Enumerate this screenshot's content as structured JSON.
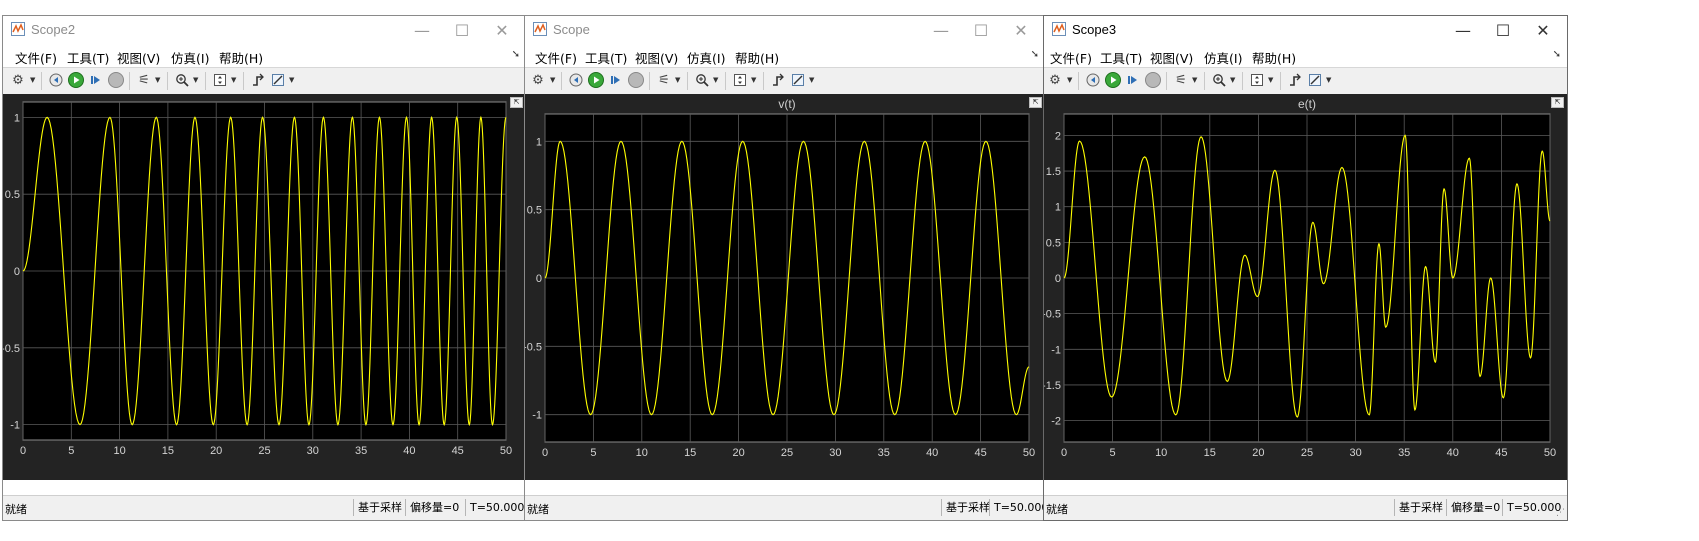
{
  "menu": [
    "文件(F)",
    "工具(T)",
    "视图(V)",
    "仿真(I)",
    "帮助(H)"
  ],
  "status": {
    "ready": "就绪",
    "sampling": "基于采样",
    "offset": "偏移量=0",
    "time": "T=50.000"
  },
  "window_controls": {
    "minimize": "—",
    "maximize": "☐",
    "close": "✕"
  },
  "colors": {
    "trace": "#ffff00",
    "plot_bg": "#000000",
    "frame_bg": "#232323",
    "grid": "#5a5a5a",
    "tick_label": "#d4d4d4"
  },
  "windows": [
    {
      "title": "Scope2",
      "active": false,
      "plot_title": ""
    },
    {
      "title": "Scope",
      "active": false,
      "plot_title": "v(t)"
    },
    {
      "title": "Scope3",
      "active": true,
      "plot_title": "e(t)"
    }
  ],
  "chart_data": [
    {
      "type": "line",
      "title": "",
      "xlabel": "",
      "ylabel": "",
      "xlim": [
        0,
        50
      ],
      "ylim": [
        -1.1,
        1.1
      ],
      "xticks": [
        0,
        5,
        10,
        15,
        20,
        25,
        30,
        35,
        40,
        45,
        50
      ],
      "yticks": [
        -1,
        -0.5,
        0,
        0.5,
        1
      ],
      "grid": true,
      "series": [
        {
          "x": [
            0,
            2.5,
            5.9,
            9,
            11.3,
            13.8,
            15.9,
            17.8,
            19.7,
            21.5,
            23.2,
            24.8,
            26.5,
            28.1,
            29.6,
            31.1,
            32.6,
            34.1,
            35.5,
            36.9,
            38.3,
            39.7,
            41.0,
            42.3,
            43.6,
            44.9,
            46.2,
            47.4,
            48.6,
            50
          ],
          "y": [
            0,
            1,
            -1,
            1,
            -1,
            1,
            -1,
            1,
            -1,
            1,
            -1,
            1,
            -1,
            1,
            -1,
            1,
            -1,
            1,
            -1,
            1,
            -1,
            1,
            -1,
            1,
            -1,
            1,
            -1,
            1,
            -1,
            1
          ]
        }
      ]
    },
    {
      "type": "line",
      "title": "v(t)",
      "xlabel": "",
      "ylabel": "",
      "xlim": [
        0,
        50
      ],
      "ylim": [
        -1.2,
        1.2
      ],
      "xticks": [
        0,
        5,
        10,
        15,
        20,
        25,
        30,
        35,
        40,
        45,
        50
      ],
      "yticks": [
        -1,
        -0.5,
        0,
        0.5,
        1
      ],
      "grid": true,
      "series": [
        {
          "x": [
            0,
            1.57,
            4.71,
            7.85,
            11.0,
            14.14,
            17.28,
            20.42,
            23.56,
            26.7,
            29.85,
            32.99,
            36.13,
            39.27,
            42.41,
            45.55,
            48.69,
            50
          ],
          "y": [
            0,
            1,
            -1,
            1,
            -1,
            1,
            -1,
            1,
            -1,
            1,
            -1,
            1,
            -1,
            1,
            -1,
            1,
            -1,
            -0.65
          ]
        }
      ]
    },
    {
      "type": "line",
      "title": "e(t)",
      "xlabel": "",
      "ylabel": "",
      "xlim": [
        0,
        50
      ],
      "ylim": [
        -2.3,
        2.3
      ],
      "xticks": [
        0,
        5,
        10,
        15,
        20,
        25,
        30,
        35,
        40,
        45,
        50
      ],
      "yticks": [
        -2,
        -1.5,
        -1,
        -0.5,
        0,
        0.5,
        1,
        1.5,
        2
      ],
      "grid": true,
      "series": [
        {
          "x": [
            0,
            1.6,
            4.9,
            8.3,
            11.5,
            14.1,
            16.8,
            18.6,
            19.9,
            21.7,
            24.0,
            25.6,
            26.7,
            28.6,
            31.4,
            32.4,
            33.1,
            35.1,
            36.1,
            37.2,
            38.2,
            39.1,
            40.0,
            41.7,
            42.8,
            43.9,
            45.2,
            46.6,
            48.0,
            49.2,
            50
          ],
          "y": [
            0,
            1.92,
            -1.67,
            1.7,
            -1.92,
            1.98,
            -1.45,
            0.32,
            -0.26,
            1.51,
            -1.95,
            0.78,
            -0.08,
            1.55,
            -1.92,
            0.48,
            -0.69,
            2.0,
            -1.85,
            0.16,
            -1.18,
            1.25,
            0.0,
            1.68,
            -1.38,
            0.0,
            -1.68,
            1.32,
            -1.12,
            1.78,
            0.8
          ]
        }
      ]
    }
  ]
}
